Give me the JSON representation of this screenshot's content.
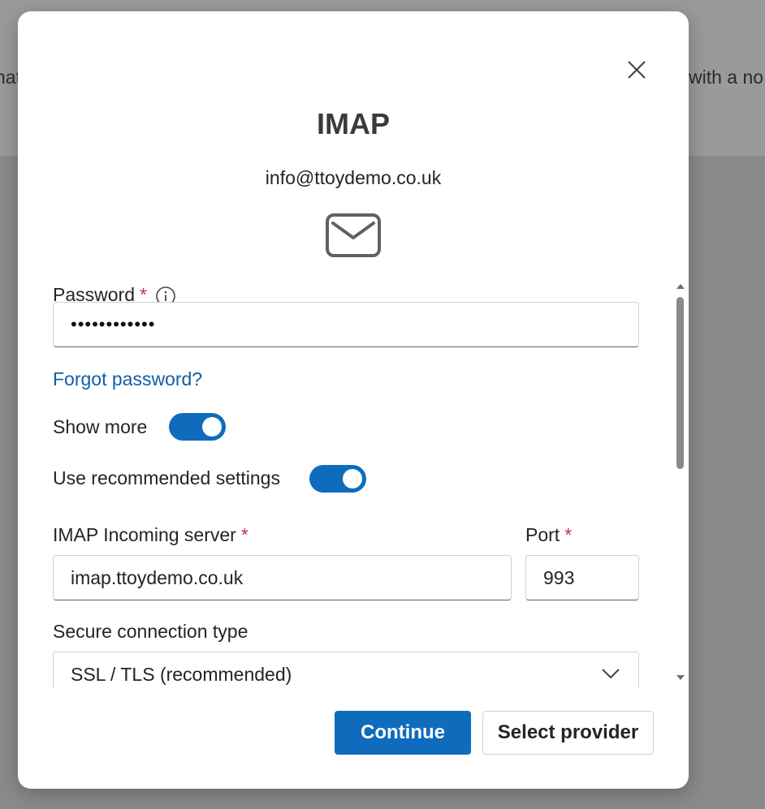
{
  "background": {
    "text_left": "hat",
    "text_right": "with a no"
  },
  "dialog": {
    "title": "IMAP",
    "email": "info@ttoydemo.co.uk",
    "close_icon": "close-icon",
    "header_icon": "mail-icon"
  },
  "form": {
    "password": {
      "label": "Password",
      "required_mark": "*",
      "info_icon": "info-icon",
      "value": "••••••••••••"
    },
    "forgot_password_link": "Forgot password?",
    "show_more": {
      "label": "Show more",
      "on": true
    },
    "use_recommended": {
      "label": "Use recommended settings",
      "on": true
    },
    "incoming_server": {
      "label": "IMAP Incoming server",
      "required_mark": "*",
      "value": "imap.ttoydemo.co.uk"
    },
    "port": {
      "label": "Port",
      "required_mark": "*",
      "value": "993"
    },
    "secure_connection": {
      "label": "Secure connection type",
      "value": "SSL / TLS (recommended)"
    }
  },
  "buttons": {
    "continue_label": "Continue",
    "select_provider_label": "Select provider"
  },
  "colors": {
    "accent": "#0f6cbd",
    "link": "#115ea3",
    "required": "#c4314b",
    "backdrop": "#8a8a8a"
  }
}
